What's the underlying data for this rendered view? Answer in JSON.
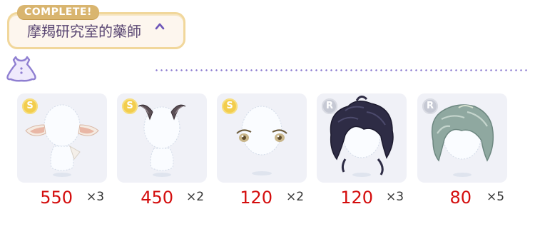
{
  "banner": {
    "status": "COMPLETE!",
    "title": "摩羯研究室的藥師",
    "caret": "chevron-up-icon"
  },
  "category": {
    "icon": "outfit-dress-icon"
  },
  "items": [
    {
      "rarity": "S",
      "price": "550",
      "qty": "×3",
      "icon": "goat-ears-icon"
    },
    {
      "rarity": "S",
      "price": "450",
      "qty": "×2",
      "icon": "goat-horns-icon"
    },
    {
      "rarity": "S",
      "price": "120",
      "qty": "×2",
      "icon": "eyes-icon"
    },
    {
      "rarity": "R",
      "price": "120",
      "qty": "×3",
      "icon": "dark-messy-hair-icon"
    },
    {
      "rarity": "R",
      "price": "80",
      "qty": "×5",
      "icon": "teal-hair-icon"
    }
  ],
  "colors": {
    "price": "#d40d0d",
    "accent": "#8f7fd1",
    "banner_border": "#f1d79b",
    "complete_tag": "#d9b56f"
  }
}
